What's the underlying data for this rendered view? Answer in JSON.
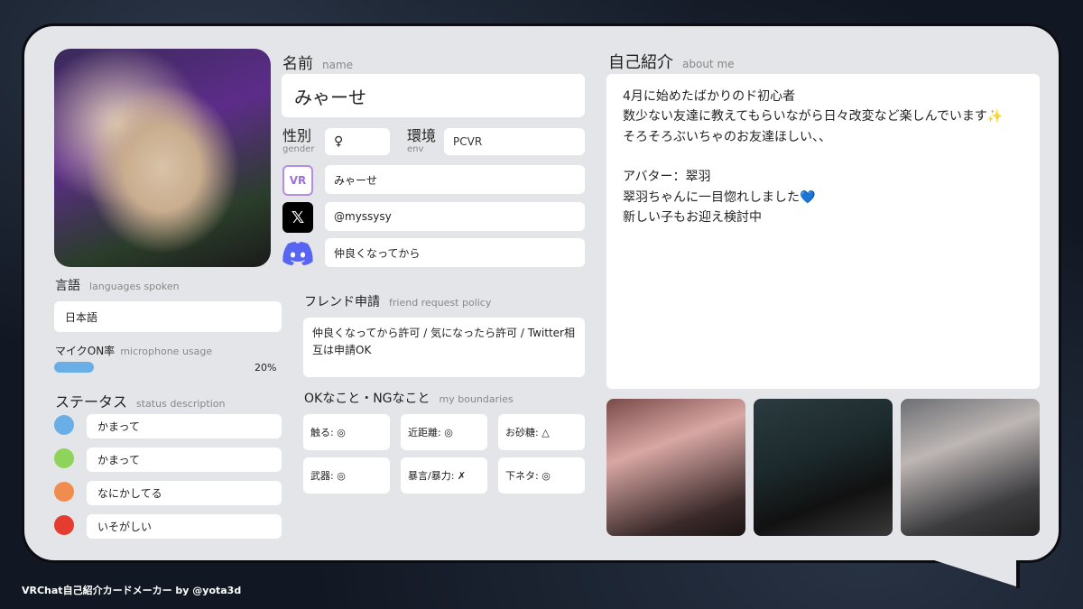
{
  "name": {
    "label_jp": "名前",
    "label_en": "name",
    "value": "みゃーせ"
  },
  "gender": {
    "label_jp": "性別",
    "label_en": "gender",
    "value": "♀"
  },
  "env": {
    "label_jp": "環境",
    "label_en": "env",
    "value": "PCVR"
  },
  "socials": [
    {
      "icon": "vrchat-icon",
      "value": "みゃーせ"
    },
    {
      "icon": "x-icon",
      "value": "@myssysy"
    },
    {
      "icon": "discord-icon",
      "value": "仲良くなってから"
    }
  ],
  "languages": {
    "label_jp": "言語",
    "label_en": "languages spoken",
    "value": "日本語"
  },
  "mic": {
    "label_jp": "マイクON率",
    "label_en": "microphone usage",
    "value": "20%",
    "fraction": 0.2
  },
  "status": {
    "label_jp": "ステータス",
    "label_en": "status description",
    "items": [
      {
        "color": "#6aaee8",
        "text": "かまって"
      },
      {
        "color": "#8fd45a",
        "text": "かまって"
      },
      {
        "color": "#f08c4e",
        "text": "なにかしてる"
      },
      {
        "color": "#e43d30",
        "text": "いそがしい"
      }
    ]
  },
  "friend_request": {
    "label_jp": "フレンド申請",
    "label_en": "friend request policy",
    "value": "仲良くなってから許可 / 気になったら許可 / Twitter相互は申請OK"
  },
  "boundaries": {
    "label_jp": "OKなこと・NGなこと",
    "label_en": "my boundaries",
    "items": [
      "触る: ◎",
      "近距離: ◎",
      "お砂糖: △",
      "武器: ◎",
      "暴言/暴力: ✗",
      "下ネタ: ◎"
    ]
  },
  "about": {
    "label_jp": "自己紹介",
    "label_en": "about me",
    "lines": [
      "4月に始めたばかりのド初心者",
      "数少ない友達に教えてもらいながら日々改変など楽しんでいます✨",
      "そろそろぶいちゃのお友達ほしい、、",
      "",
      "アバター：翠羽",
      "翠羽ちゃんに一目惚れしました💙",
      "新しい子もお迎え検討中"
    ]
  },
  "footer": "VRChat自己紹介カードメーカー by @yota3d",
  "colors": {
    "card": "#e4e5e8",
    "mic_bar": "#6aaee8"
  }
}
